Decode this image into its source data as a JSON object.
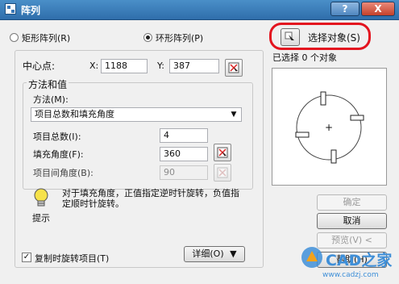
{
  "window": {
    "title": "阵列",
    "help_label": "?",
    "close_label": "X"
  },
  "mode": {
    "rect_label": "矩形阵列(R)",
    "polar_label": "环形阵列(P)",
    "selected": "polar"
  },
  "center": {
    "label": "中心点:",
    "x_label": "X:",
    "x_value": "1188",
    "y_label": "Y:",
    "y_value": "387"
  },
  "method_group": {
    "title": "方法和值",
    "method_label": "方法(M):",
    "method_value": "项目总数和填充角度",
    "total_label": "项目总数(I):",
    "total_value": "4",
    "fill_label": "填充角度(F):",
    "fill_value": "360",
    "between_label": "项目间角度(B):",
    "between_value": "90"
  },
  "tip": {
    "text": "对于填充角度，正值指定逆时针旋转，负值指定顺时针旋转。",
    "caption": "提示"
  },
  "rotate_items": {
    "label": "复制时旋转项目(T)",
    "checked": true,
    "check_glyph": "✓"
  },
  "details_button": {
    "label": "详细(O)",
    "arrow": "▼"
  },
  "select_objects": {
    "label": "选择对象(S)",
    "status": "已选择 0 个对象"
  },
  "buttons": {
    "ok": "确定",
    "cancel": "取消",
    "preview": "预览(V) <",
    "help": "帮助(H)"
  },
  "preview": {
    "center_mark": "+"
  },
  "watermark": {
    "text": "CAD之家",
    "url": "www.cadzj.com"
  },
  "colors": {
    "title_bar": "#3a78b8",
    "highlight_outline": "#e3141f",
    "watermark": "#3f8fd8"
  }
}
